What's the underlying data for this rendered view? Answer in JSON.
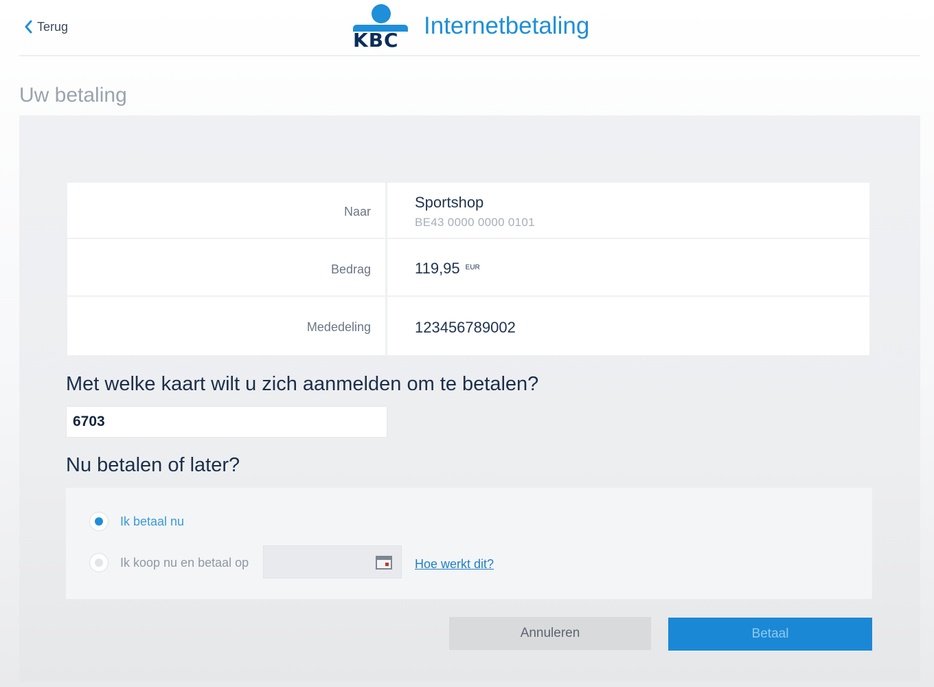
{
  "header": {
    "back_label": "Terug",
    "logo_text": "KBC",
    "title": "Internetbetaling"
  },
  "page_title": "Uw betaling",
  "payment": {
    "to_label": "Naar",
    "to_name": "Sportshop",
    "to_iban": "BE43 0000 0000 0101",
    "amount_label": "Bedrag",
    "amount_value": "119,95",
    "amount_currency": "EUR",
    "message_label": "Mededeling",
    "message_value": "123456789002"
  },
  "card_question": "Met welke kaart wilt u zich aanmelden om te betalen?",
  "card_input": {
    "value": "6703"
  },
  "pay_question": "Nu betalen of later?",
  "options": {
    "pay_now_label": "Ik betaal nu",
    "pay_now_selected": true,
    "pay_later_label": "Ik koop nu en betaal op",
    "pay_later_selected": false,
    "help_link": "Hoe werkt dit?"
  },
  "buttons": {
    "cancel_label": "Annuleren",
    "pay_label": "Betaal"
  },
  "colors": {
    "brand_blue": "#1e8fd8",
    "brand_navy": "#0a2d5a",
    "primary_button": "#1b88d6",
    "secondary_button": "#d9dadc"
  }
}
